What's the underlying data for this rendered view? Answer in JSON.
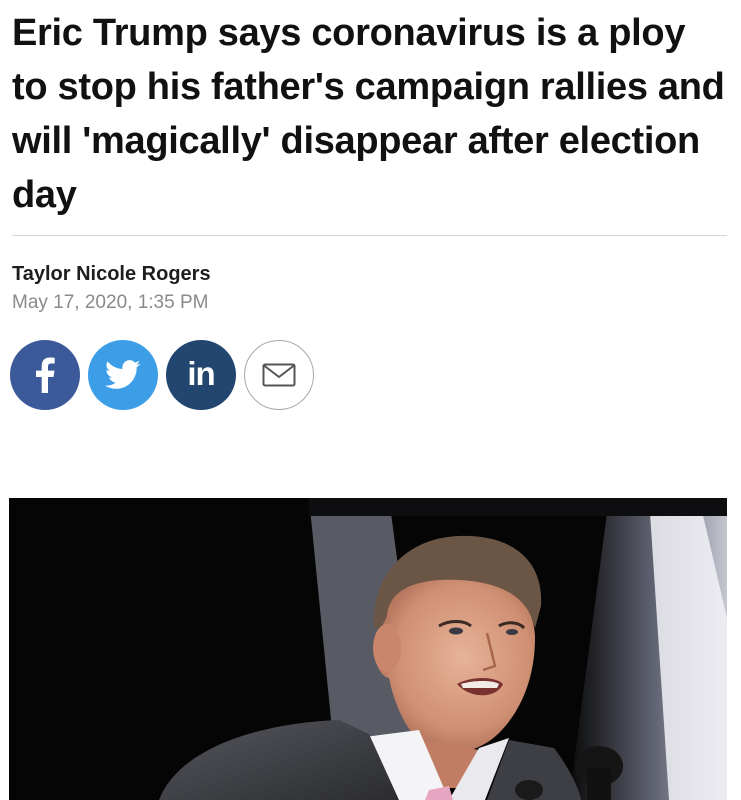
{
  "article": {
    "headline": "Eric Trump says coronavirus is a ploy to stop his father's campaign rallies and will 'magically' disappear after election day",
    "author": "Taylor Nicole Rogers",
    "published": "May 17, 2020, 1:35 PM"
  },
  "share": {
    "buttons": [
      {
        "network": "facebook",
        "icon": "facebook-icon",
        "color": "#3c5a99"
      },
      {
        "network": "twitter",
        "icon": "twitter-icon",
        "color": "#3d9ee8"
      },
      {
        "network": "linkedin",
        "icon": "linkedin-icon",
        "label": "in",
        "color": "#22466f"
      },
      {
        "network": "email",
        "icon": "envelope-icon",
        "color": "#ffffff"
      }
    ]
  },
  "hero_image": {
    "subject": "photo"
  },
  "colors": {
    "text": "#111111",
    "date": "#8a8a8a",
    "divider": "#d4d4d4"
  }
}
